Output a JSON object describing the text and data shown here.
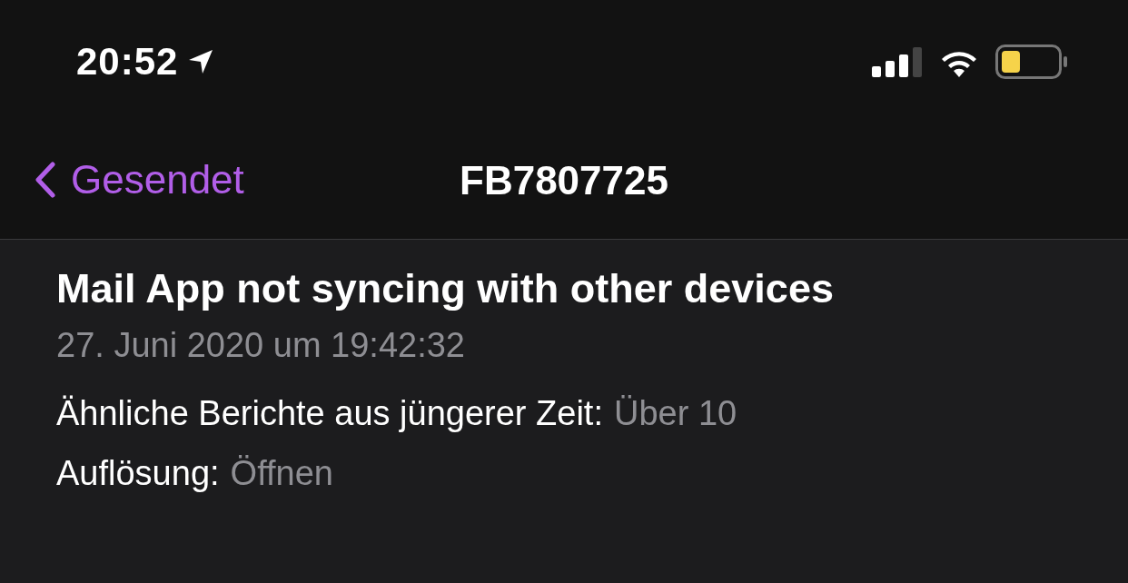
{
  "status_bar": {
    "time": "20:52"
  },
  "nav_bar": {
    "back_label": "Gesendet",
    "title": "FB7807725"
  },
  "report": {
    "title": "Mail App not syncing with other devices",
    "date": "27. Juni 2020 um 19:42:32",
    "fields": [
      {
        "label": "Ähnliche Berichte aus jüngerer Zeit:",
        "value": "Über 10"
      },
      {
        "label": "Auflösung:",
        "value": "Öffnen"
      }
    ]
  }
}
